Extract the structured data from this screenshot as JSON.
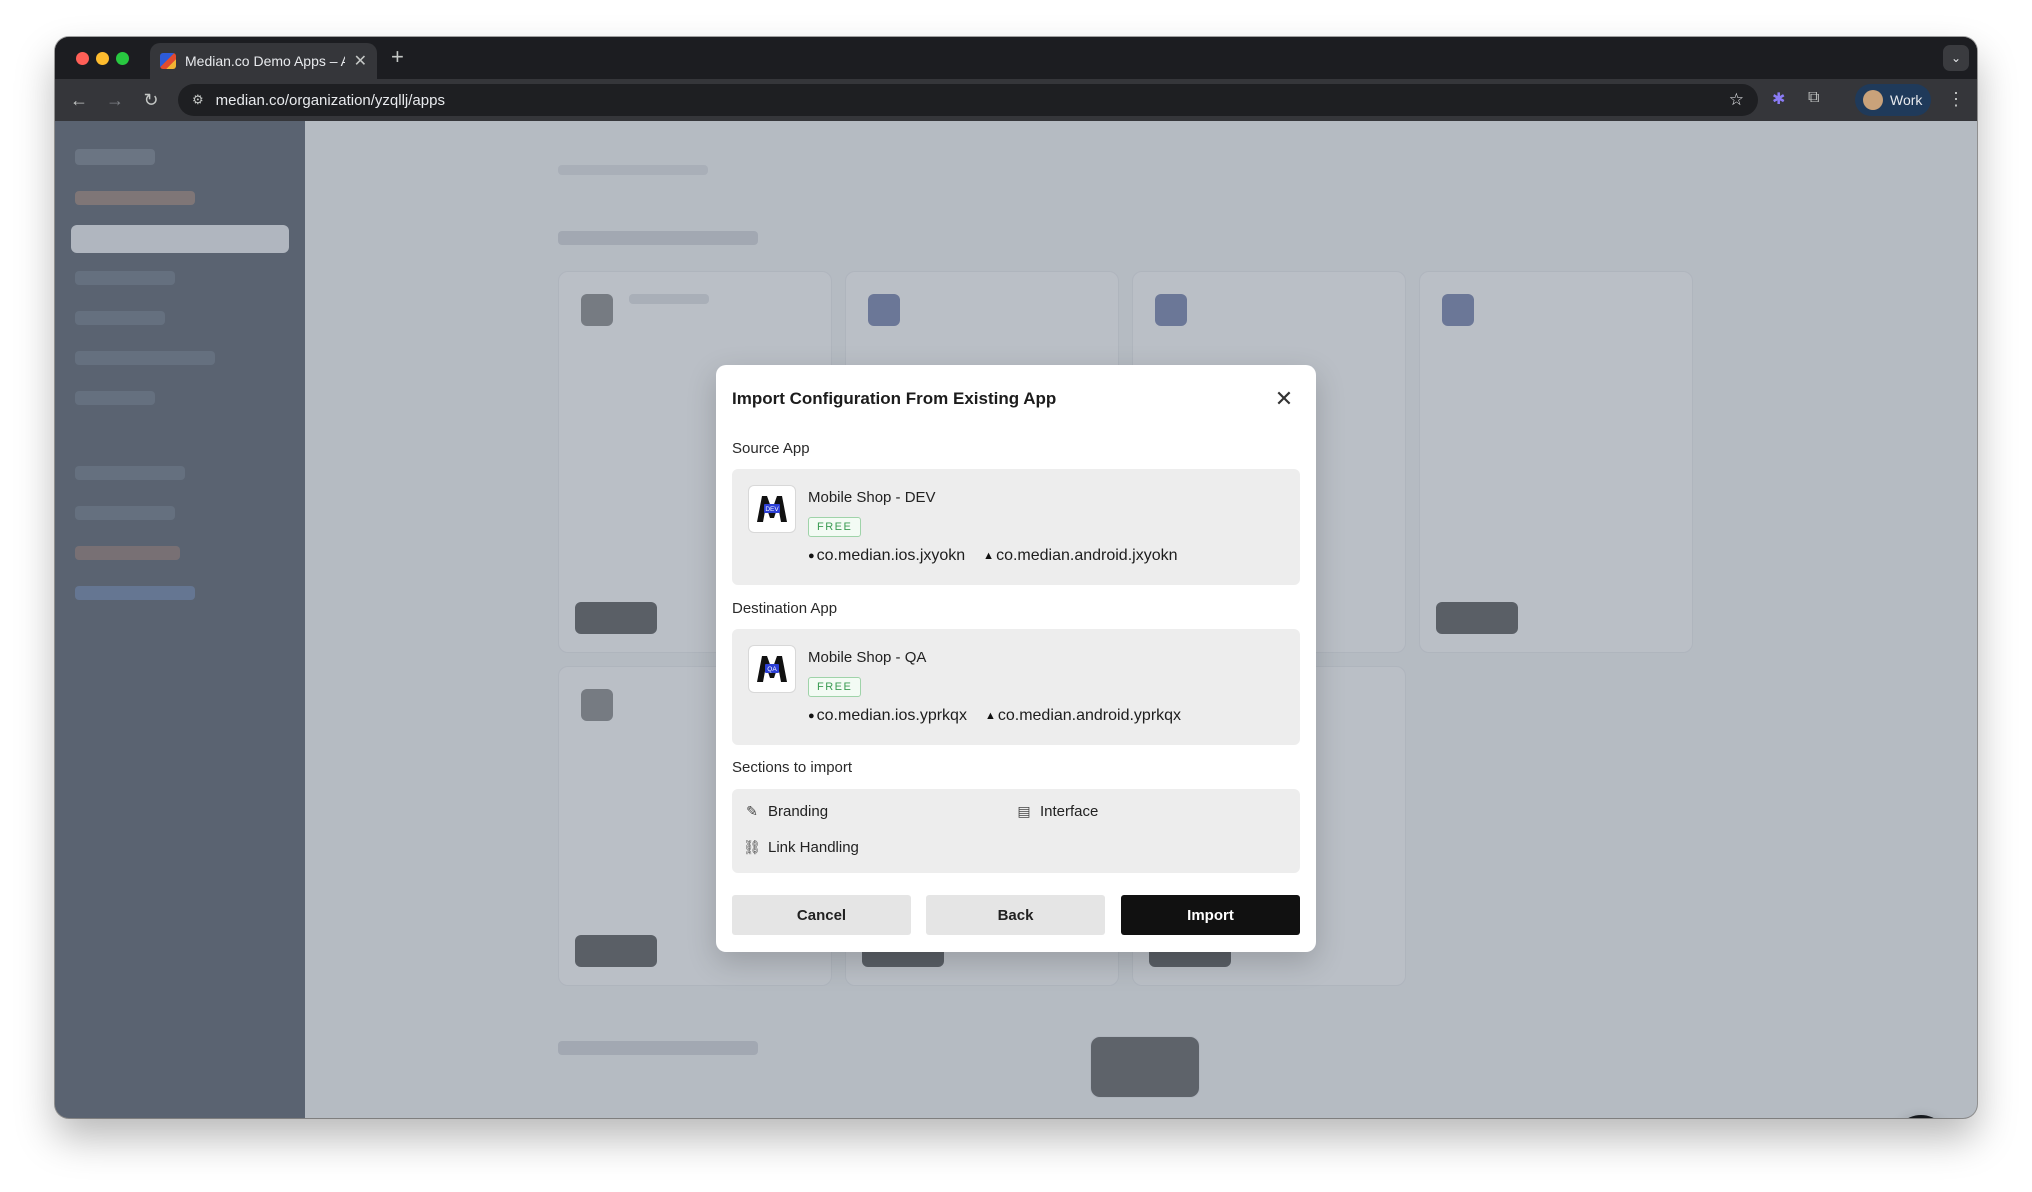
{
  "browser": {
    "tab_title": "Median.co Demo Apps – App",
    "tab_close": "✕",
    "new_tab": "+",
    "url": "median.co/organization/yzqllj/apps",
    "profile_label": "Work"
  },
  "modal": {
    "title": "Import Configuration From Existing App",
    "source_label": "Source App",
    "destination_label": "Destination App",
    "sections_label": "Sections to import",
    "source": {
      "name": "Mobile Shop - DEV",
      "badge": "FREE",
      "logo_tag": "DEV",
      "ios_bundle": "co.median.ios.jxyokn",
      "android_bundle": "co.median.android.jxyokn"
    },
    "destination": {
      "name": "Mobile Shop - QA",
      "badge": "FREE",
      "logo_tag": "QA",
      "ios_bundle": "co.median.ios.yprkqx",
      "android_bundle": "co.median.android.yprkqx"
    },
    "sections": {
      "branding": "Branding",
      "interface": "Interface",
      "link_handling": "Link Handling"
    },
    "buttons": {
      "cancel": "Cancel",
      "back": "Back",
      "import": "Import"
    }
  },
  "colors": {
    "badge_green": "#3a9b52",
    "primary_button": "#111111",
    "logo_blue": "#2c3fd6"
  }
}
